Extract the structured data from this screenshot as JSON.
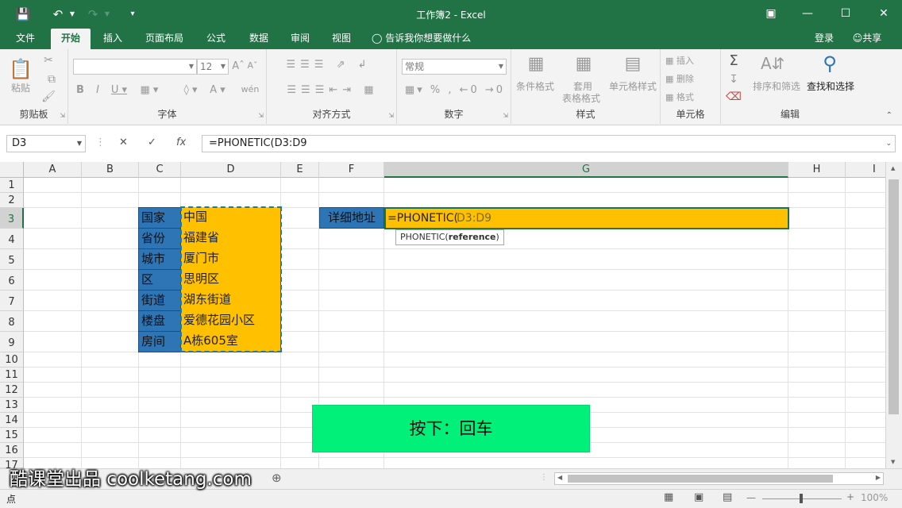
{
  "window": {
    "title": "工作簿2 - Excel",
    "undo_icon": "undo-icon",
    "redo_icon": "redo-icon",
    "save_icon": "save-icon"
  },
  "tabs": [
    "文件",
    "开始",
    "插入",
    "页面布局",
    "公式",
    "数据",
    "审阅",
    "视图"
  ],
  "active_tab": "开始",
  "tellme": "告诉我你想要做什么",
  "signin": "登录",
  "share": "共享",
  "ribbon": {
    "clipboard": {
      "label": "剪贴板",
      "paste": "粘贴"
    },
    "font": {
      "label": "字体",
      "size": "12"
    },
    "alignment": {
      "label": "对齐方式"
    },
    "number": {
      "label": "数字",
      "format": "常规"
    },
    "styles": {
      "label": "样式",
      "cond": "条件格式",
      "table1": "套用",
      "table2": "表格格式",
      "cellstyle": "单元格样式"
    },
    "cells": {
      "label": "单元格",
      "insert": "插入",
      "delete": "删除",
      "format": "格式"
    },
    "editing": {
      "label": "编辑",
      "sort": "排序和筛选",
      "find": "查找和选择"
    }
  },
  "formula_bar": {
    "name_box": "D3",
    "formula": "=PHONETIC(D3:D9"
  },
  "columns": [
    "A",
    "B",
    "C",
    "D",
    "E",
    "F",
    "G",
    "H",
    "I"
  ],
  "rows": [
    "1",
    "2",
    "3",
    "4",
    "5",
    "6",
    "7",
    "8",
    "9",
    "10",
    "11",
    "12",
    "13",
    "14",
    "15",
    "16",
    "17"
  ],
  "table": {
    "labels": [
      "国家",
      "省份",
      "城市",
      "区",
      "街道",
      "楼盘",
      "房间"
    ],
    "values": [
      "中国",
      "福建省",
      "厦门市",
      "思明区",
      "湖东街道",
      "爱德花园小区",
      "A栋605室"
    ]
  },
  "f3_label": "详细地址",
  "g3_formula_prefix": "=PHONETIC(",
  "g3_formula_ref": "D3:D9",
  "tooltip": {
    "fn": "PHONETIC(",
    "arg": "reference",
    "close": ")"
  },
  "banner": "按下：回车",
  "status": {
    "mode": "点",
    "zoom": "100%"
  },
  "watermark": "酷课堂出品 coolketang.com",
  "colors": {
    "excel_green": "#217346",
    "cell_orange": "#ffc000",
    "cell_blue": "#2e75b6",
    "banner_green": "#00f07a"
  }
}
